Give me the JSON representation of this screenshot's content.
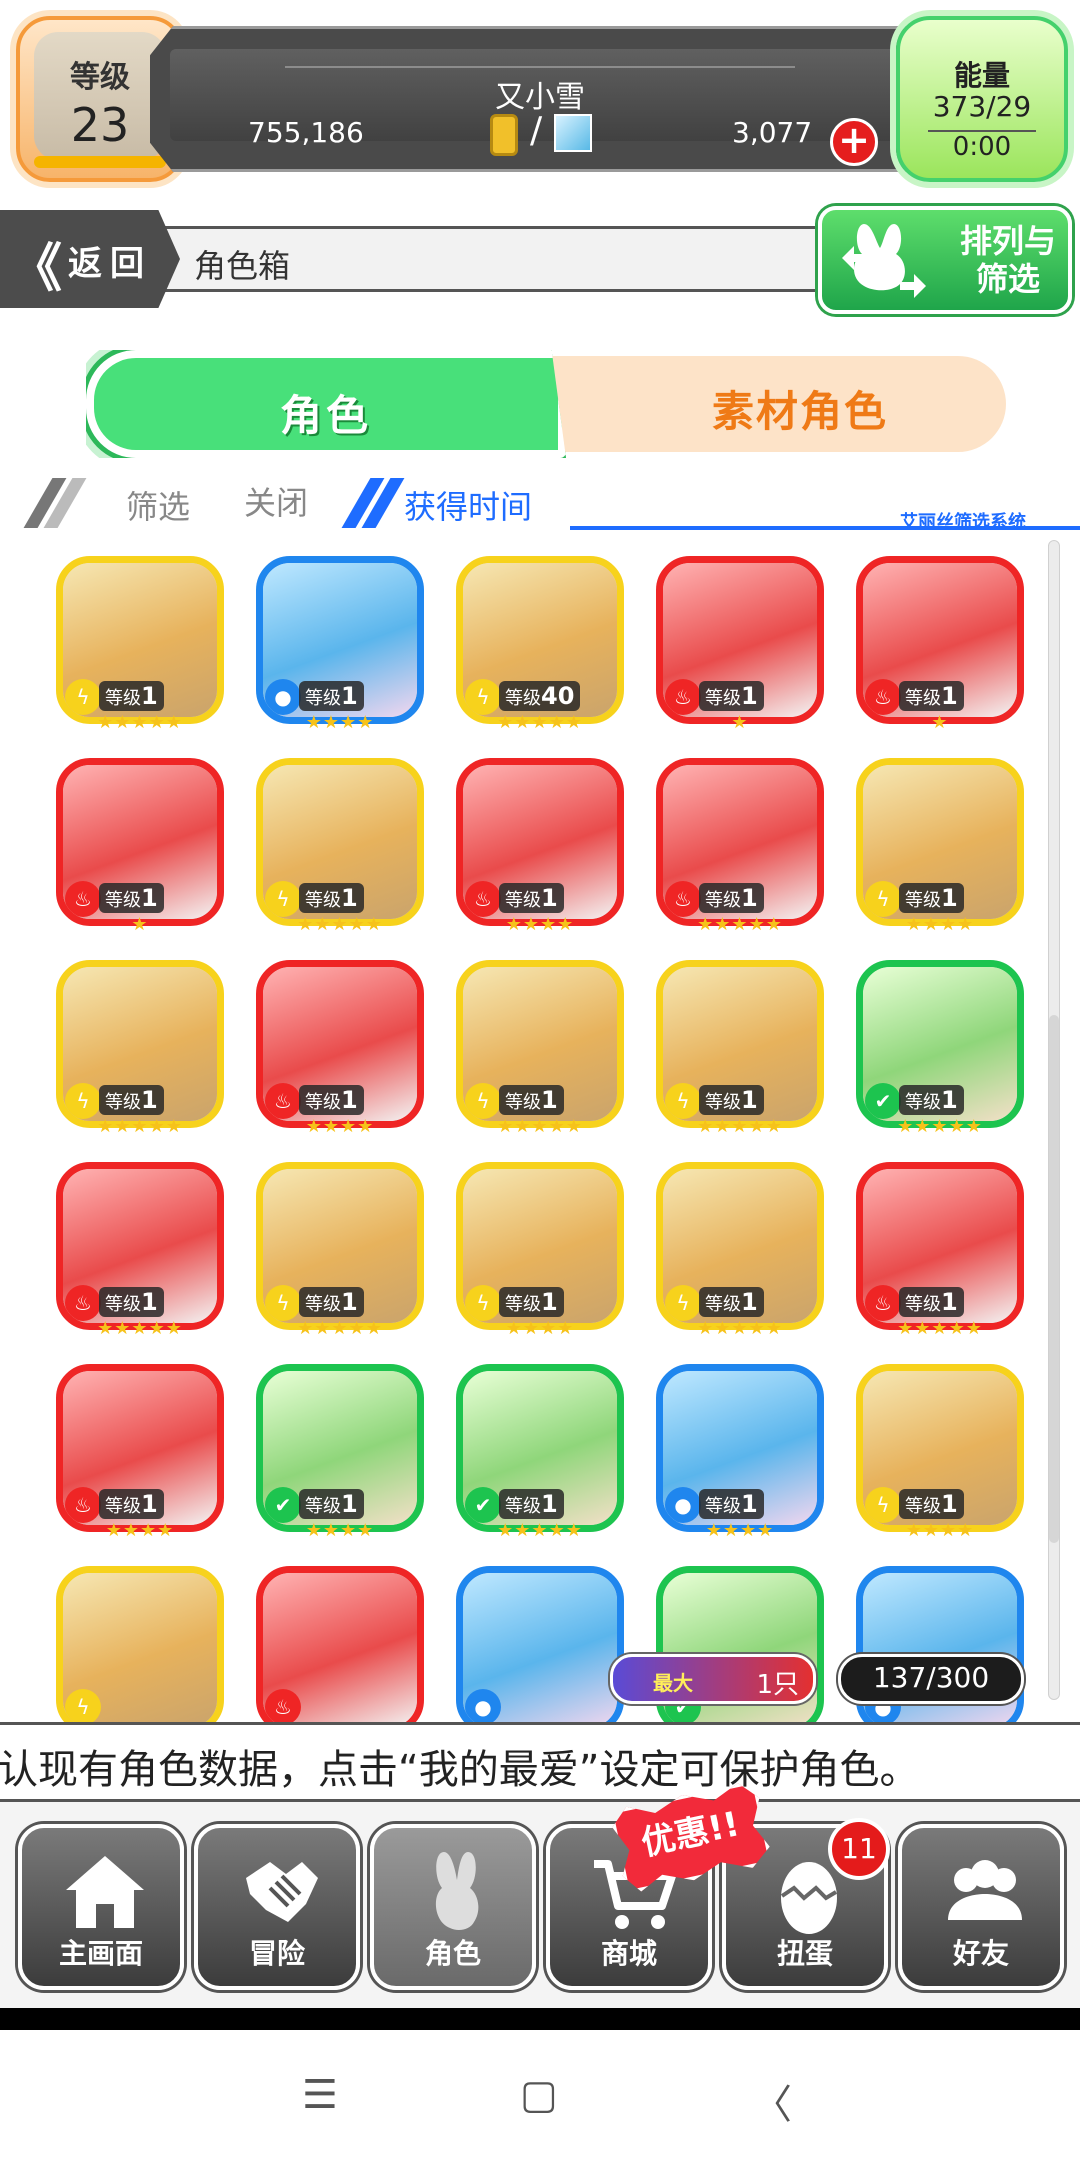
{
  "header": {
    "level_label": "等级",
    "level_value": "23",
    "player_name": "又小雪",
    "gold": "755,186",
    "separator": "/",
    "gems": "3,077",
    "add_symbol": "+",
    "energy_label": "能量",
    "energy_value": "373/29",
    "energy_timer": "0:00"
  },
  "nav": {
    "back_chevron": "《",
    "back_label": "返回",
    "breadcrumb": "角色箱",
    "sort_filter_label": "排列与筛选"
  },
  "tabs": [
    {
      "label": "角色",
      "active": true
    },
    {
      "label": "素材角色",
      "active": false
    }
  ],
  "filter": {
    "filter_label": "筛选",
    "filter_value": "关闭",
    "sort_value": "获得时间",
    "system_label": "艾丽丝筛选系统"
  },
  "grid": {
    "level_prefix": "等级",
    "cards": [
      {
        "color": "yellow",
        "element": "lightning",
        "level": "1",
        "stars": "★★★★★"
      },
      {
        "color": "blue",
        "element": "water",
        "level": "1",
        "stars": "★★★★"
      },
      {
        "color": "yellow",
        "element": "lightning",
        "level": "40",
        "stars": "★★★★★"
      },
      {
        "color": "red",
        "element": "fire",
        "level": "1",
        "stars": "★"
      },
      {
        "color": "red",
        "element": "fire",
        "level": "1",
        "stars": "★"
      },
      {
        "color": "red",
        "element": "fire",
        "level": "1",
        "stars": "★"
      },
      {
        "color": "yellow",
        "element": "lightning",
        "level": "1",
        "stars": "★★★★★"
      },
      {
        "color": "red",
        "element": "fire",
        "level": "1",
        "stars": "★★★★"
      },
      {
        "color": "red",
        "element": "fire",
        "level": "1",
        "stars": "★★★★★"
      },
      {
        "color": "yellow",
        "element": "lightning",
        "level": "1",
        "stars": "★★★★"
      },
      {
        "color": "yellow",
        "element": "lightning",
        "level": "1",
        "stars": "★★★★★"
      },
      {
        "color": "red",
        "element": "fire",
        "level": "1",
        "stars": "★★★★"
      },
      {
        "color": "yellow",
        "element": "lightning",
        "level": "1",
        "stars": "★★★★★"
      },
      {
        "color": "yellow",
        "element": "lightning",
        "level": "1",
        "stars": "★★★★★"
      },
      {
        "color": "green",
        "element": "wind",
        "level": "1",
        "stars": "★★★★★"
      },
      {
        "color": "red",
        "element": "fire",
        "level": "1",
        "stars": "★★★★★"
      },
      {
        "color": "yellow",
        "element": "lightning",
        "level": "1",
        "stars": "★★★★★"
      },
      {
        "color": "yellow",
        "element": "lightning",
        "level": "1",
        "stars": "★★★★"
      },
      {
        "color": "yellow",
        "element": "lightning",
        "level": "1",
        "stars": "★★★★★"
      },
      {
        "color": "red",
        "element": "fire",
        "level": "1",
        "stars": "★★★★★"
      },
      {
        "color": "red",
        "element": "fire",
        "level": "1",
        "stars": "★★★★"
      },
      {
        "color": "green",
        "element": "wind",
        "level": "1",
        "stars": "★★★★"
      },
      {
        "color": "green",
        "element": "wind",
        "level": "1",
        "stars": "★★★★★"
      },
      {
        "color": "blue",
        "element": "water",
        "level": "1",
        "stars": "★★★★"
      },
      {
        "color": "yellow",
        "element": "lightning",
        "level": "1",
        "stars": "★★★★"
      },
      {
        "color": "yellow",
        "element": "lightning",
        "level": "",
        "stars": ""
      },
      {
        "color": "red",
        "element": "fire",
        "level": "",
        "stars": ""
      },
      {
        "color": "blue",
        "element": "water",
        "level": "",
        "stars": ""
      },
      {
        "color": "green",
        "element": "wind",
        "level": "",
        "stars": ""
      },
      {
        "color": "blue",
        "element": "water",
        "level": "",
        "stars": ""
      }
    ]
  },
  "max_badge": {
    "label": "最大",
    "value": "1只"
  },
  "count_badge": "137/300",
  "hint": "认现有角色数据，点击“我的最爱”设定可保护角色。",
  "bottom_nav": [
    {
      "label": "主画面",
      "icon": "home-icon"
    },
    {
      "label": "冒险",
      "icon": "handshake-icon"
    },
    {
      "label": "角色",
      "icon": "rabbit-icon"
    },
    {
      "label": "商城",
      "icon": "cart-icon"
    },
    {
      "label": "扭蛋",
      "icon": "egg-icon"
    },
    {
      "label": "好友",
      "icon": "friends-icon"
    }
  ],
  "sale_badge": "优惠!!",
  "gacha_badge_count": "11",
  "system_nav": {
    "menu": "☰",
    "home": "▢",
    "back": "〈"
  },
  "colors": {
    "yellow": "#f7d21c",
    "red": "#ef2525",
    "blue": "#1f86ee",
    "green": "#1dc44f",
    "accent_green": "#48e07a",
    "accent_orange": "#ef7a16",
    "accent_blue": "#1e6cff"
  }
}
